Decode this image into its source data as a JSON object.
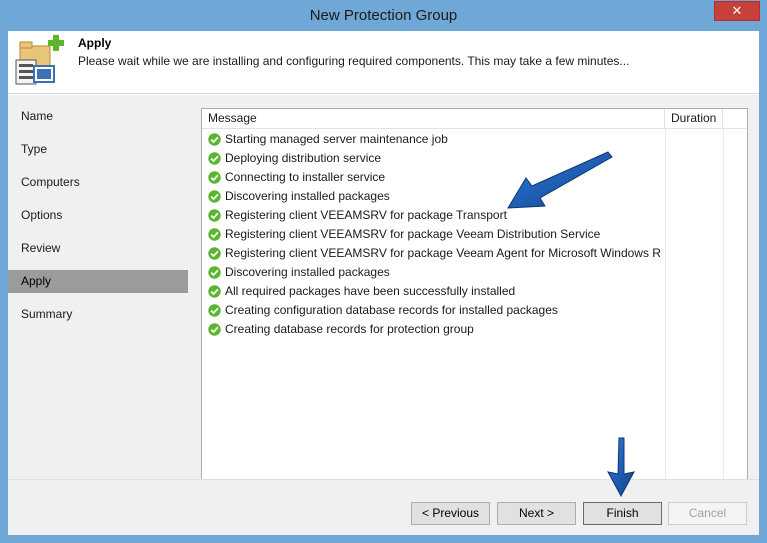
{
  "window": {
    "title": "New Protection Group",
    "close_glyph": "✕"
  },
  "header": {
    "title": "Apply",
    "description": "Please wait while we are installing and configuring required components. This may take a few minutes...",
    "icon": "protection-group-add-icon"
  },
  "sidebar": {
    "items": [
      {
        "label": "Name",
        "active": false
      },
      {
        "label": "Type",
        "active": false
      },
      {
        "label": "Computers",
        "active": false
      },
      {
        "label": "Options",
        "active": false
      },
      {
        "label": "Review",
        "active": false
      },
      {
        "label": "Apply",
        "active": true
      },
      {
        "label": "Summary",
        "active": false
      }
    ]
  },
  "log": {
    "columns": {
      "message": "Message",
      "duration": "Duration"
    },
    "status_icon": "success-check-icon",
    "rows": [
      {
        "message": "Starting managed server maintenance job",
        "duration": ""
      },
      {
        "message": "Deploying distribution service",
        "duration": ""
      },
      {
        "message": "Connecting to installer service",
        "duration": ""
      },
      {
        "message": "Discovering installed packages",
        "duration": ""
      },
      {
        "message": "Registering client VEEAMSRV for package Transport",
        "duration": ""
      },
      {
        "message": "Registering client VEEAMSRV for package Veeam Distribution Service",
        "duration": ""
      },
      {
        "message": "Registering client VEEAMSRV for package Veeam Agent for Microsoft Windows R...",
        "duration": ""
      },
      {
        "message": "Discovering installed packages",
        "duration": ""
      },
      {
        "message": "All required packages have been successfully installed",
        "duration": ""
      },
      {
        "message": "Creating configuration database records for installed packages",
        "duration": ""
      },
      {
        "message": "Creating database records for protection group",
        "duration": ""
      }
    ]
  },
  "footer": {
    "previous": "< Previous",
    "next": "Next >",
    "finish": "Finish",
    "cancel": "Cancel"
  },
  "colors": {
    "titlebar": "#6fa8d6",
    "success": "#5cb531",
    "annotation_arrow": "#1a5fb4"
  }
}
